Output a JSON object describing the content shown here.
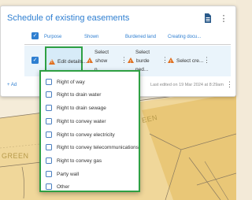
{
  "panel": {
    "title": "Schedule of existing easements",
    "footer": {
      "add_label": "+ Ad",
      "last_edited": "Last edited on 19 Mar 2024 at 8:29am"
    }
  },
  "table": {
    "headers": [
      "Purpose",
      "Shown",
      "Burdened land",
      "Creating docu..."
    ],
    "row": {
      "purpose": "Edit details...",
      "shown": [
        "Select",
        "show",
        "n..."
      ],
      "burdened": [
        "Select",
        "burde",
        "ned..."
      ],
      "creating": "Select cre..."
    }
  },
  "dropdown": {
    "options": [
      "Right of way",
      "Right to drain water",
      "Right to drain sewage",
      "Right to convey water",
      "Right to convey electricity",
      "Right to convey telecommunications",
      "Right to convey gas",
      "Party wall",
      "Other"
    ]
  },
  "map": {
    "labels": [
      "GREEN",
      "EEN"
    ]
  },
  "colors": {
    "accent": "#2f7fd1",
    "highlight": "#2ea043",
    "warning": "#e07020"
  }
}
